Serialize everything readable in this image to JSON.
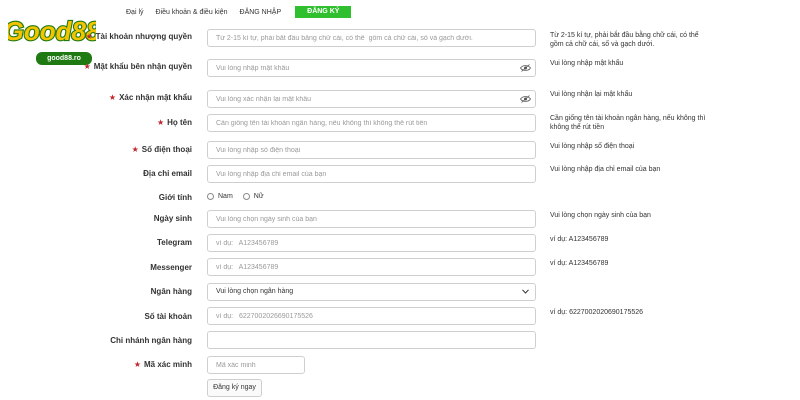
{
  "logo": {
    "brand": "Good88",
    "domain": "good88.ro"
  },
  "nav": {
    "items": [
      "Đại lý",
      "Điều khoản & điều kiện",
      "ĐĂNG NHẬP"
    ],
    "register": "ĐĂNG KÝ"
  },
  "form": {
    "account": {
      "label": "Tài khoản nhượng quyền",
      "placeholder": "Từ 2-15 kí tự, phải bắt đầu bằng chữ cái, có thể  gồm cả chữ cái, số và gạch dưới.",
      "hint": "Từ 2-15 kí tự, phải bắt đầu bằng chữ cái, có thể gồm cả chữ cái, số và gạch dưới."
    },
    "password": {
      "label": "Mật khẩu bên nhận quyền",
      "placeholder": "Vui lòng nhập mật khẩu",
      "hint": "Vui lòng nhập mật khẩu"
    },
    "confirm": {
      "label": "Xác nhận mật khẩu",
      "placeholder": "Vui lòng xác nhận lại mật khẩu",
      "hint": "Vui lòng nhận lại mật khẩu"
    },
    "fullname": {
      "label": "Họ tên",
      "placeholder": "Cần giống tên tài khoản ngân hàng, nếu không thì không thể rút tiền",
      "hint": "Cần giống tên tài khoản ngân hàng, nếu không thì không thể rút tiền"
    },
    "phone": {
      "label": "Số điện thoại",
      "placeholder": "Vui lòng nhập số điện thoại",
      "hint": "Vui lòng nhập số điện thoại"
    },
    "email": {
      "label": "Địa chỉ email",
      "placeholder": "Vui lòng nhập địa chỉ email của bạn",
      "hint": "Vui lòng nhập địa chỉ email của bạn"
    },
    "gender": {
      "label": "Giới tính",
      "options": [
        "Nam",
        "Nữ"
      ]
    },
    "birthday": {
      "label": "Ngày sinh",
      "placeholder": "Vui lòng chọn ngày sinh của bạn",
      "hint": "Vui lòng chọn ngày sinh của bạn"
    },
    "telegram": {
      "label": "Telegram",
      "placeholder": "ví dụ:   A123456789",
      "hint": "ví dụ:   A123456789"
    },
    "messenger": {
      "label": "Messenger",
      "placeholder": "ví dụ:   A123456789",
      "hint": "ví dụ:   A123456789"
    },
    "bank": {
      "label": "Ngân hàng",
      "selected": "Vui lòng chọn ngân hàng"
    },
    "account_number": {
      "label": "Số tài khoản",
      "placeholder": "ví dụ:   6227002026690175526",
      "hint": "ví dụ:   6227002020690175526"
    },
    "branch": {
      "label": "Chi nhánh ngân hàng",
      "placeholder": ""
    },
    "captcha": {
      "label": "Mã xác minh",
      "placeholder": "Mã xác minh"
    },
    "submit": "Đăng ký ngay"
  },
  "colors": {
    "register_bg": "#2fbf2f",
    "required_star": "#c0272d",
    "logo_yellow": "#f5c400",
    "logo_green": "#1f7a12"
  }
}
